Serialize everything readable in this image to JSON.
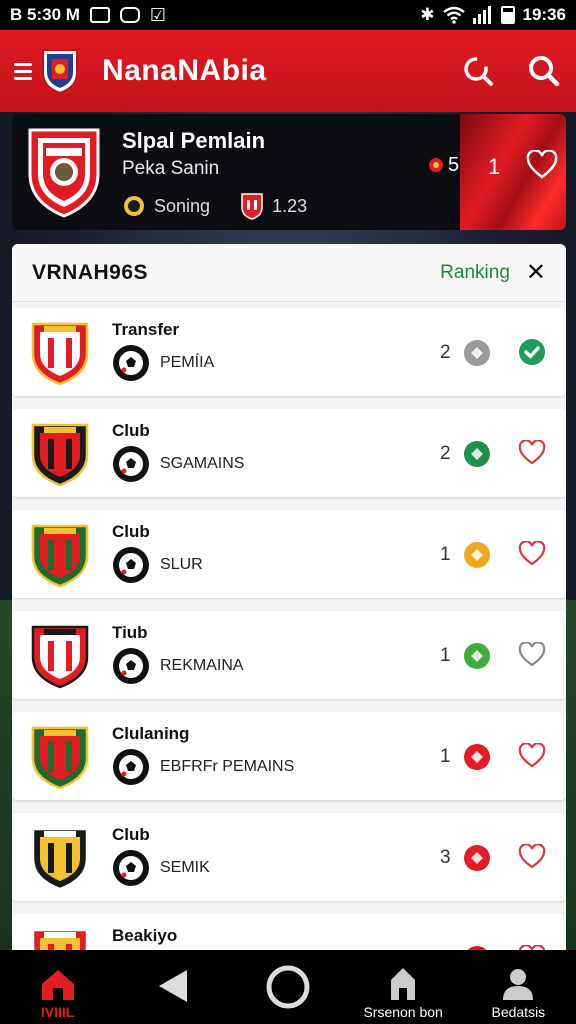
{
  "status_bar": {
    "left_text": "B 5:30 M",
    "time": "19:36"
  },
  "app_bar": {
    "title": "NanaNAbia"
  },
  "featured": {
    "title": "Slpal Pemlain",
    "subtitle": "Peka Sanin",
    "stat1_label": "Soning",
    "stat2_value": "1.23",
    "count": "5",
    "number": "1"
  },
  "panel": {
    "title": "VRNAH96S",
    "tab_label": "Ranking",
    "close_symbol": "✕"
  },
  "rows": [
    {
      "label": "Transfer",
      "sub": "PEMÍIA",
      "num": "2",
      "badge_color": "#9a9a9a",
      "fav_state": "check"
    },
    {
      "label": "Club",
      "sub": "SGAMAINS",
      "num": "2",
      "badge_color": "#1f8f4e",
      "fav_state": "heart"
    },
    {
      "label": "Club",
      "sub": "SLUR",
      "num": "1",
      "badge_color": "#f2a51f",
      "fav_state": "heart"
    },
    {
      "label": "Tiub",
      "sub": "REKMAINA",
      "num": "1",
      "badge_color": "#3cae3c",
      "fav_state": "heart-gray"
    },
    {
      "label": "Clulaning",
      "sub": "EBFRFr PEMAINS",
      "num": "1",
      "badge_color": "#e31b23",
      "fav_state": "heart"
    },
    {
      "label": "Club",
      "sub": "SEMIK",
      "num": "3",
      "badge_color": "#e31b23",
      "fav_state": "heart"
    },
    {
      "label": "Beakiyo",
      "sub": "",
      "num": "",
      "badge_color": "#e31b23",
      "fav_state": "heart"
    }
  ],
  "bottom_nav": {
    "home_label": "IVIIIL",
    "season_label": "Srsenon bon",
    "profile_label": "Bedatsis"
  },
  "colors": {
    "brand_red": "#e31b23",
    "accent_green": "#1a8a3a"
  }
}
